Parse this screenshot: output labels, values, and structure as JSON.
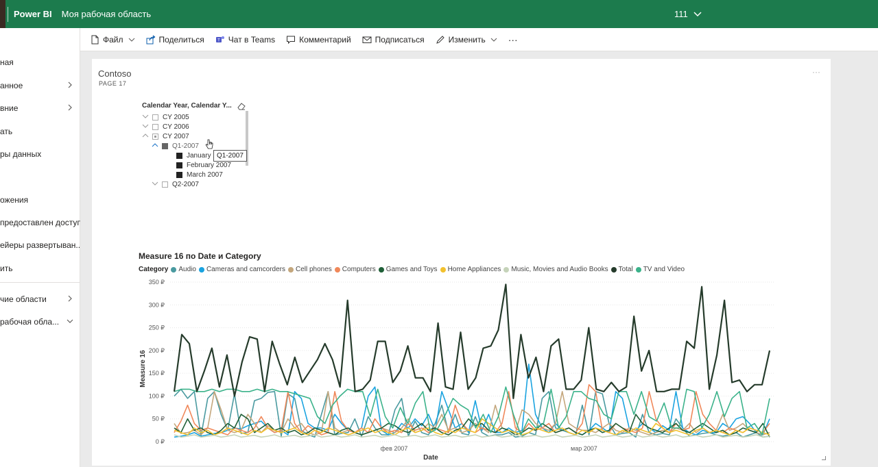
{
  "header": {
    "brand": "Power BI",
    "workspace": "Моя рабочая область",
    "user": "111"
  },
  "nav": {
    "items": [
      {
        "label": "ная",
        "chevron": false
      },
      {
        "label": "анное",
        "chevron": true
      },
      {
        "label": "вние",
        "chevron": true
      },
      {
        "label": "ать",
        "chevron": false
      },
      {
        "label": "ры данных",
        "chevron": false
      },
      {
        "label": "",
        "chevron": false
      },
      {
        "label": "ожения",
        "chevron": false
      },
      {
        "label": "предоставлен доступ",
        "chevron": false
      },
      {
        "label": "ейеры развертыван...",
        "chevron": false
      },
      {
        "label": "ить",
        "chevron": false
      },
      {
        "label": "чие области",
        "chevron": true
      },
      {
        "label": "рабочая обла...",
        "chevron": true,
        "down": true
      }
    ]
  },
  "actions": [
    {
      "name": "file",
      "label": "Файл",
      "icon": "file-icon",
      "caret": true
    },
    {
      "name": "share",
      "label": "Поделиться",
      "icon": "share-icon",
      "caret": false
    },
    {
      "name": "teams",
      "label": "Чат в Teams",
      "icon": "teams-icon",
      "caret": false
    },
    {
      "name": "comment",
      "label": "Комментарий",
      "icon": "comment-icon",
      "caret": false
    },
    {
      "name": "subscribe",
      "label": "Подписаться",
      "icon": "mail-icon",
      "caret": false
    },
    {
      "name": "edit",
      "label": "Изменить",
      "icon": "pencil-icon",
      "caret": true
    }
  ],
  "more": "···",
  "report": {
    "title": "Contoso",
    "page": "PAGE 17"
  },
  "slicer": {
    "header": "Calendar Year, Calendar Y...",
    "rows": [
      {
        "label": "CY 2005",
        "level": 0,
        "exp": "﹀",
        "state": "empty"
      },
      {
        "label": "CY 2006",
        "level": 0,
        "exp": "﹀",
        "state": "empty"
      },
      {
        "label": "CY 2007",
        "level": 0,
        "exp": "︿",
        "state": "partial"
      },
      {
        "label": "Q1-2007",
        "level": 1,
        "exp": "︿",
        "state": "grey"
      },
      {
        "label": "January 2007",
        "level": 2,
        "exp": "",
        "state": "filled"
      },
      {
        "label": "February 2007",
        "level": 2,
        "exp": "",
        "state": "filled"
      },
      {
        "label": "March 2007",
        "level": 2,
        "exp": "",
        "state": "filled"
      },
      {
        "label": "Q2-2007",
        "level": 1,
        "exp": "﹀",
        "state": "empty"
      }
    ],
    "tooltip": "Q1-2007"
  },
  "chart": {
    "title": "Measure 16 по Date и Category",
    "legend_label": "Category"
  },
  "chart_data": {
    "type": "line",
    "title": "Measure 16 по Date и Category",
    "xlabel": "Date",
    "ylabel": "Measure 16",
    "ylim": [
      0,
      350
    ],
    "yticks": [
      0,
      50,
      100,
      150,
      200,
      250,
      300,
      350
    ],
    "ytick_labels": [
      "0 ₽",
      "50 ₽",
      "100 ₽",
      "150 ₽",
      "200 ₽",
      "250 ₽",
      "300 ₽",
      "350 ₽"
    ],
    "x_range": [
      "2007-01-01",
      "2007-03-31"
    ],
    "xtick_labels": [
      {
        "label": "фев 2007",
        "date": "2007-02-01"
      },
      {
        "label": "мар 2007",
        "date": "2007-03-01"
      }
    ],
    "grid": true,
    "legend_position": "top-left",
    "series": [
      {
        "name": "Audio",
        "color": "#4a9aa0",
        "values": [
          100,
          115,
          95,
          110,
          12,
          95,
          110,
          60,
          25,
          105,
          18,
          20,
          90,
          95,
          108,
          110,
          12,
          105,
          95,
          25,
          15,
          10,
          60,
          110,
          15,
          18,
          20,
          50,
          12,
          55,
          30,
          15,
          15,
          70,
          95,
          12,
          45,
          20,
          15,
          40,
          80,
          20,
          60,
          18,
          15,
          55,
          20,
          12,
          15,
          15,
          20,
          10,
          12,
          20,
          15,
          95,
          110,
          30,
          25,
          20,
          15,
          80,
          15,
          110,
          105,
          40,
          15,
          18,
          20,
          10,
          60,
          20,
          15,
          18,
          15,
          50,
          30,
          12,
          15,
          18,
          20,
          15,
          12,
          15,
          20,
          10,
          15,
          20,
          10,
          12
        ]
      },
      {
        "name": "Cameras and camcorders",
        "color": "#1aa3e0",
        "values": [
          10,
          12,
          15,
          20,
          12,
          15,
          18,
          20,
          25,
          30,
          28,
          35,
          40,
          45,
          30,
          20,
          25,
          15,
          110,
          95,
          40,
          30,
          30,
          25,
          60,
          40,
          25,
          20,
          30,
          100,
          120,
          25,
          15,
          20,
          40,
          30,
          50,
          35,
          60,
          25,
          110,
          70,
          30,
          40,
          20,
          90,
          25,
          60,
          20,
          20,
          30,
          20,
          25,
          170,
          60,
          30,
          20,
          40,
          25,
          30,
          20,
          15,
          25,
          40,
          30,
          20,
          110,
          95,
          30,
          25,
          40,
          30,
          20,
          35,
          25,
          110,
          30,
          20,
          15,
          25,
          20,
          20,
          40,
          30,
          50,
          55,
          40,
          20,
          15,
          50
        ]
      },
      {
        "name": "Cell phones",
        "color": "#c4a77d",
        "values": [
          40,
          18,
          20,
          25,
          15,
          30,
          110,
          70,
          25,
          20,
          25,
          60,
          40,
          20,
          35,
          25,
          20,
          50,
          30,
          40,
          20,
          15,
          20,
          110,
          30,
          20,
          25,
          20,
          15,
          20,
          25,
          30,
          25,
          20,
          30,
          50,
          20,
          25,
          40,
          30,
          60,
          25,
          30,
          20,
          25,
          40,
          30,
          20,
          80,
          30,
          25,
          20,
          70,
          60,
          40,
          30,
          25,
          40,
          110,
          40,
          30,
          25,
          25,
          20,
          30,
          40,
          25,
          20,
          30,
          25,
          20,
          15,
          20,
          25,
          20,
          30,
          25,
          40,
          20,
          30,
          20,
          25,
          60,
          25,
          30,
          40,
          25,
          20,
          15,
          20
        ]
      },
      {
        "name": "Computers",
        "color": "#f0885a",
        "values": [
          20,
          45,
          80,
          40,
          25,
          30,
          25,
          20,
          15,
          30,
          25,
          20,
          30,
          55,
          30,
          20,
          25,
          110,
          40,
          20,
          35,
          25,
          15,
          20,
          110,
          45,
          25,
          20,
          30,
          20,
          50,
          30,
          20,
          25,
          20,
          40,
          25,
          30,
          20,
          30,
          25,
          20,
          80,
          40,
          25,
          20,
          30,
          25,
          20,
          40,
          110,
          30,
          20,
          40,
          25,
          30,
          40,
          20,
          25,
          30,
          20,
          40,
          125,
          110,
          25,
          20,
          40,
          30,
          25,
          20,
          30,
          110,
          50,
          30,
          20,
          40,
          25,
          30,
          110,
          60,
          40,
          25,
          20,
          30,
          25,
          20,
          30,
          25,
          20,
          40
        ]
      },
      {
        "name": "Games and Toys",
        "color": "#1f5f37",
        "values": [
          30,
          20,
          50,
          25,
          30,
          20,
          15,
          25,
          40,
          30,
          60,
          50,
          20,
          30,
          40,
          25,
          30,
          20,
          25,
          15,
          20,
          30,
          25,
          20,
          15,
          25,
          30,
          20,
          15,
          20,
          25,
          30,
          40,
          35,
          25,
          20,
          30,
          40,
          25,
          30,
          20,
          15,
          25,
          30,
          50,
          35,
          40,
          25,
          20,
          30,
          25,
          15,
          20,
          30,
          25,
          40,
          30,
          20,
          25,
          30,
          20,
          15,
          25,
          30,
          20,
          25,
          40,
          30,
          20,
          60,
          40,
          30,
          25,
          20,
          30,
          40,
          25,
          20,
          30,
          40,
          30,
          20,
          25,
          15,
          20,
          30,
          25,
          20,
          40,
          10
        ]
      },
      {
        "name": "Home Appliances",
        "color": "#f2c12e",
        "values": [
          25,
          20,
          15,
          30,
          20,
          25,
          15,
          20,
          30,
          25,
          20,
          15,
          25,
          20,
          30,
          25,
          20,
          25,
          30,
          20,
          15,
          25,
          20,
          30,
          25,
          20,
          15,
          20,
          25,
          30,
          20,
          25,
          20,
          15,
          25,
          30,
          20,
          25,
          30,
          20,
          15,
          25,
          20,
          30,
          25,
          20,
          50,
          40,
          30,
          20,
          25,
          20,
          15,
          20,
          30,
          25,
          20,
          25,
          30,
          20,
          15,
          25,
          20,
          30,
          25,
          20,
          15,
          25,
          20,
          30,
          25,
          20,
          40,
          30,
          20,
          25,
          20,
          15,
          25,
          30,
          20,
          25,
          20,
          15,
          25,
          20,
          30,
          25,
          20,
          15
        ]
      },
      {
        "name": "Music, Movies and Audio Books",
        "color": "#c5d3b9",
        "values": [
          15,
          10,
          12,
          15,
          10,
          12,
          14,
          10,
          12,
          15,
          10,
          12,
          14,
          10,
          12,
          15,
          10,
          12,
          14,
          10,
          12,
          15,
          10,
          12,
          14,
          10,
          12,
          15,
          10,
          12,
          14,
          10,
          12,
          15,
          10,
          12,
          14,
          10,
          12,
          15,
          10,
          12,
          14,
          10,
          12,
          15,
          10,
          12,
          14,
          10,
          12,
          15,
          10,
          12,
          14,
          10,
          12,
          15,
          10,
          12,
          14,
          10,
          12,
          15,
          10,
          12,
          14,
          10,
          12,
          15,
          10,
          12,
          14,
          10,
          12,
          15,
          10,
          12,
          14,
          10,
          12,
          15,
          10,
          12,
          14,
          10,
          12,
          15,
          10,
          12
        ]
      },
      {
        "name": "Total",
        "color": "#253b2b",
        "values": [
          110,
          235,
          215,
          110,
          155,
          205,
          120,
          190,
          100,
          175,
          230,
          225,
          110,
          220,
          170,
          125,
          185,
          130,
          155,
          180,
          215,
          180,
          120,
          310,
          110,
          115,
          135,
          220,
          220,
          130,
          155,
          210,
          140,
          140,
          110,
          260,
          120,
          115,
          240,
          115,
          140,
          205,
          210,
          245,
          345,
          95,
          235,
          140,
          185,
          110,
          210,
          225,
          115,
          115,
          135,
          250,
          115,
          110,
          130,
          110,
          120,
          275,
          155,
          200,
          110,
          110,
          115,
          115,
          220,
          205,
          340,
          115,
          190,
          310,
          130,
          135,
          110,
          125,
          125,
          200
        ]
      },
      {
        "name": "TV and Video",
        "color": "#3bb28a",
        "values": [
          110,
          115,
          115,
          110,
          110,
          115,
          110,
          115,
          115,
          110,
          110,
          115,
          110,
          115,
          110,
          110,
          105,
          100,
          95,
          55,
          40,
          80,
          100,
          115,
          110,
          110,
          55,
          115,
          55,
          30,
          75,
          40,
          85,
          110,
          20,
          30,
          60,
          95,
          80,
          70,
          30,
          60,
          20,
          55,
          120,
          60,
          15,
          50,
          30,
          40,
          115,
          30,
          55,
          110,
          110,
          95,
          90,
          60,
          50,
          110,
          110,
          60,
          110,
          55,
          45,
          85,
          30,
          30,
          115,
          110,
          30,
          60,
          110,
          55,
          95,
          110,
          30,
          40,
          15,
          95
        ]
      }
    ]
  }
}
